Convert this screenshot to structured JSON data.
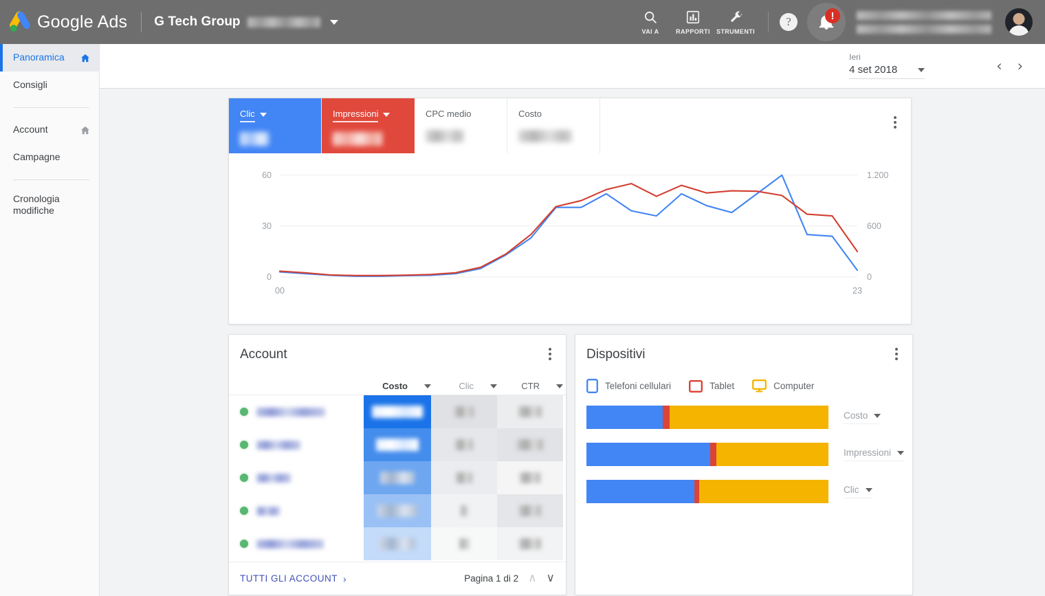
{
  "app": {
    "brand": "Google Ads",
    "account_name": "G Tech Group",
    "account_id_redacted": true
  },
  "topbar": {
    "tools": [
      {
        "name": "search",
        "label": "VAI A",
        "icon": "search-icon"
      },
      {
        "name": "reports",
        "label": "RAPPORTI",
        "icon": "bar-chart-icon"
      },
      {
        "name": "tools",
        "label": "STRUMENTI",
        "icon": "wrench-icon"
      }
    ],
    "help_glyph": "?",
    "notification_badge": "!",
    "avatar_label": "avatar"
  },
  "sidebar": {
    "items": [
      {
        "label": "Panoramica",
        "active": true,
        "icon": "home-icon",
        "icon_active": true
      },
      {
        "label": "Consigli",
        "active": false,
        "icon": null
      },
      {
        "sep": true
      },
      {
        "label": "Account",
        "active": false,
        "icon": "home-icon",
        "icon_active": false
      },
      {
        "label": "Campagne",
        "active": false,
        "icon": null
      },
      {
        "sep": true
      },
      {
        "label": "Cronologia modifiche",
        "active": false,
        "icon": null
      }
    ]
  },
  "daterange": {
    "preset_label": "Ieri",
    "date_label": "4 set 2018",
    "prev_glyph": "‹",
    "next_glyph": "›"
  },
  "metrics": [
    {
      "label": "Clic",
      "selected": true,
      "color": "#4285f4",
      "value_redacted": true
    },
    {
      "label": "Impressioni",
      "selected": true,
      "color": "#e1483c",
      "value_redacted": true
    },
    {
      "label": "CPC medio",
      "selected": false,
      "color": "#ffffff",
      "value_redacted": true
    },
    {
      "label": "Costo",
      "selected": false,
      "color": "#ffffff",
      "value_redacted": true
    }
  ],
  "chart_data": {
    "type": "line",
    "title": "",
    "xlabel": "",
    "ylabel": "",
    "x": [
      "00",
      "01",
      "02",
      "03",
      "04",
      "05",
      "06",
      "07",
      "08",
      "09",
      "10",
      "11",
      "12",
      "13",
      "14",
      "15",
      "16",
      "17",
      "18",
      "19",
      "20",
      "21",
      "22",
      "23"
    ],
    "xtick_labels": [
      "00",
      "23"
    ],
    "left_axis": {
      "label": "Clic",
      "ticks": [
        0,
        30,
        60
      ],
      "ylim": [
        0,
        68
      ]
    },
    "right_axis": {
      "label": "Impressioni",
      "ticks": [
        0,
        600,
        1200
      ],
      "ylim": [
        0,
        1360
      ],
      "tick_labels": [
        "0",
        "600",
        "1.200"
      ]
    },
    "grid": true,
    "legend_position": "none",
    "series": [
      {
        "name": "Clic",
        "color": "#4285f4",
        "axis": "left",
        "values": [
          3,
          2,
          1,
          0.5,
          0.5,
          0.8,
          1,
          2,
          5,
          13,
          23,
          41,
          41,
          49,
          39,
          36,
          49,
          42,
          38,
          49,
          60,
          25,
          24,
          4
        ]
      },
      {
        "name": "Impressioni",
        "color": "#d23f31",
        "axis": "right",
        "values": [
          70,
          50,
          25,
          18,
          18,
          22,
          30,
          50,
          115,
          270,
          500,
          830,
          900,
          1030,
          1100,
          950,
          1080,
          990,
          1015,
          1010,
          960,
          740,
          720,
          300
        ]
      }
    ]
  },
  "account_card": {
    "title": "Account",
    "columns": [
      {
        "label": "",
        "key": "name",
        "sortable": false,
        "selected": false
      },
      {
        "label": "Costo",
        "key": "costo",
        "sortable": true,
        "selected": true
      },
      {
        "label": "Clic",
        "key": "clic",
        "sortable": true,
        "selected": false
      },
      {
        "label": "CTR",
        "key": "ctr",
        "sortable": true,
        "selected": false
      }
    ],
    "rows": [
      {
        "status": "enabled",
        "name_redacted": true,
        "name_width": 100,
        "costo_pct": 100,
        "costo_w": 74,
        "clic_w": 28,
        "ctr_w": 34
      },
      {
        "status": "enabled",
        "name_redacted": true,
        "name_width": 64,
        "costo_pct": 96,
        "costo_w": 62,
        "clic_w": 26,
        "ctr_w": 38
      },
      {
        "status": "enabled",
        "name_redacted": true,
        "name_width": 50,
        "costo_pct": 88,
        "costo_w": 50,
        "clic_w": 24,
        "ctr_w": 30
      },
      {
        "status": "enabled",
        "name_redacted": true,
        "name_width": 34,
        "costo_pct": 84,
        "costo_w": 58,
        "clic_w": 10,
        "ctr_w": 32
      },
      {
        "status": "enabled",
        "name_redacted": true,
        "name_width": 98,
        "costo_pct": 80,
        "costo_w": 52,
        "clic_w": 14,
        "ctr_w": 32
      }
    ],
    "footer": {
      "all_accounts_label": "TUTTI GLI ACCOUNT",
      "all_accounts_chevron": "›",
      "page_label": "Pagina 1 di 2",
      "prev_glyph": "∧",
      "next_glyph": "∨"
    }
  },
  "devices_card": {
    "title": "Dispositivi",
    "legend": [
      {
        "label": "Telefoni cellulari",
        "color": "#4285f4",
        "icon": "mobile-phone-icon"
      },
      {
        "label": "Tablet",
        "color": "#db4437",
        "icon": "tablet-icon"
      },
      {
        "label": "Computer",
        "color": "#f4b400",
        "icon": "desktop-computer-icon"
      }
    ],
    "chart_data": {
      "type": "bar",
      "subtype": "stacked-horizontal-100",
      "categories": [
        "Costo",
        "Impressioni",
        "Clic"
      ],
      "series": [
        {
          "name": "Telefoni cellulari",
          "color": "#4285f4",
          "values": [
            31.5,
            51.0,
            44.5
          ]
        },
        {
          "name": "Tablet",
          "color": "#db4437",
          "values": [
            2.8,
            2.8,
            2.0
          ]
        },
        {
          "name": "Computer",
          "color": "#f4b400",
          "values": [
            65.7,
            46.2,
            53.5
          ]
        }
      ],
      "ylim": [
        0,
        100
      ],
      "grid": false,
      "legend_position": "top"
    }
  },
  "colors": {
    "appbar": "#6e6e6e",
    "accent_blue": "#4285f4",
    "accent_red": "#e1483c",
    "accent_yellow": "#f4b400",
    "accent_green": "#34a853",
    "link_indigo": "#3f51b5",
    "page_bg": "#f1f3f4"
  }
}
